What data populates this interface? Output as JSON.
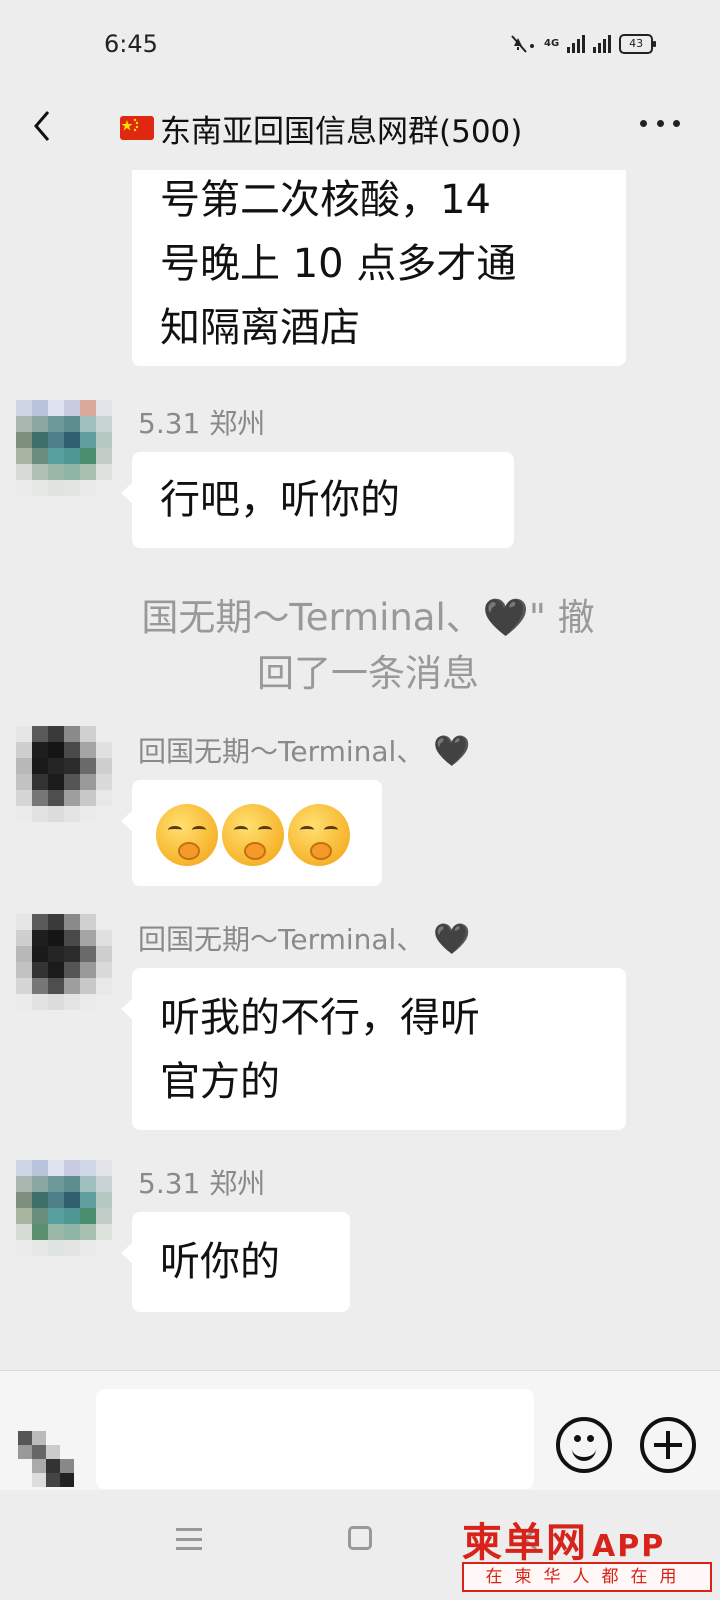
{
  "status_bar": {
    "time": "6:45",
    "signal_label": "4G",
    "battery": "43"
  },
  "header": {
    "title": "东南亚回国信息网群(500)"
  },
  "messages": [
    {
      "lines": [
        "号第二次核酸，14",
        "号晚上 10 点多才通",
        "知隔离酒店"
      ]
    },
    {
      "sender": "5.31  郑州",
      "text": "行吧，听你的"
    },
    {
      "recall_line1": "国无期～Terminal、🖤\" 撤",
      "recall_line2": "回了一条消息"
    },
    {
      "sender": "回国无期～Terminal、",
      "heart": "🖤",
      "emoji_count": 3
    },
    {
      "sender": "回国无期～Terminal、",
      "heart": "🖤",
      "lines": [
        "听我的不行，得听",
        "官方的"
      ]
    },
    {
      "sender": "5.31  郑州",
      "text": "听你的"
    }
  ],
  "input": {
    "placeholder": ""
  },
  "watermark": {
    "brand": "柬单网",
    "app": "APP",
    "tagline": "在柬华人都在用"
  },
  "colors": {
    "accent": "#d8231a",
    "chat_bg": "#ededed",
    "bubble": "#ffffff"
  },
  "icons": [
    "back-icon",
    "flag-icon",
    "more-icon",
    "smile-icon",
    "plus-icon",
    "menu-icon",
    "home-icon"
  ]
}
